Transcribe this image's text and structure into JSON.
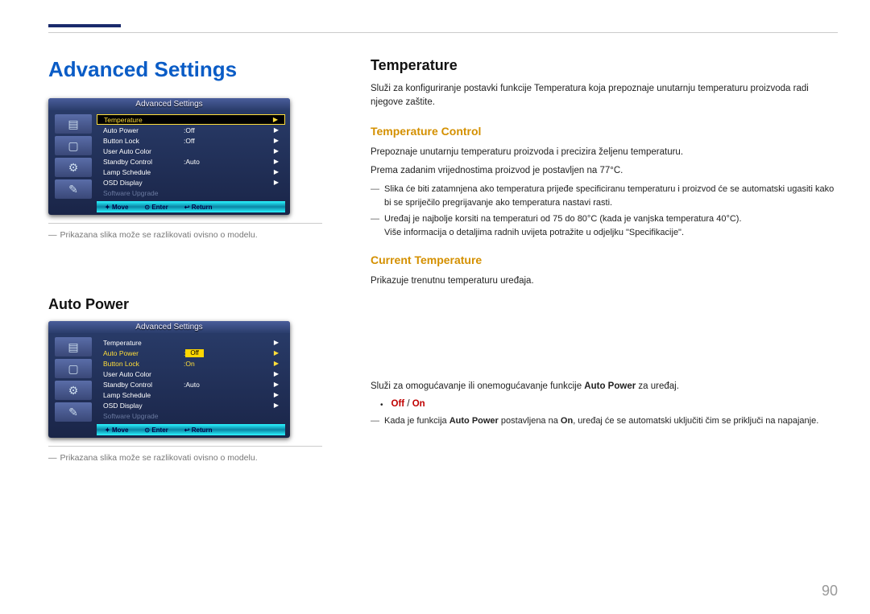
{
  "page_number": "90",
  "headings": {
    "advanced_settings": "Advanced Settings",
    "auto_power": "Auto Power",
    "temperature": "Temperature",
    "temperature_control": "Temperature Control",
    "current_temperature": "Current Temperature"
  },
  "notes": {
    "image_disclaimer": "Prikazana slika može se razlikovati ovisno o modelu.",
    "dash": "―"
  },
  "temperature": {
    "intro": "Služi za konfiguriranje postavki funkcije Temperatura koja prepoznaje unutarnju temperaturu proizvoda radi njegove zaštite.",
    "control_p1": "Prepoznaje unutarnju temperaturu proizvoda i precizira željenu temperaturu.",
    "control_p2": "Prema zadanim vrijednostima proizvod je postavljen na 77°C.",
    "control_n1": "Slika će biti zatamnjena ako temperatura prijeđe specificiranu temperaturu i proizvod će se automatski ugasiti kako bi se spriječilo pregrijavanje ako temperatura nastavi rasti.",
    "control_n2_a": "Uređaj je najbolje korsiti na temperaturi od 75 do 80°C (kada je vanjska temperatura 40°C).",
    "control_n2_b": "Više informacija o detaljima radnih uvijeta potražite u odjeljku \"Specifikacije\".",
    "current_p1": "Prikazuje trenutnu temperaturu uređaja."
  },
  "auto_power": {
    "intro_pre": "Služi za omogućavanje ili onemogućavanje funkcije ",
    "intro_bold": "Auto Power",
    "intro_post": " za uređaj.",
    "opt_off": "Off",
    "opt_sep": " / ",
    "opt_on": "On",
    "note_pre": "Kada je funkcija ",
    "note_mid": " postavljena na ",
    "note_on": "On",
    "note_post": ", uređaj će se automatski uključiti čim se priključi na napajanje."
  },
  "osd": {
    "title": "Advanced Settings",
    "rows": {
      "temperature": "Temperature",
      "auto_power": "Auto Power",
      "button_lock": "Button Lock",
      "user_auto_color": "User Auto Color",
      "standby_control": "Standby Control",
      "lamp_schedule": "Lamp Schedule",
      "osd_display": "OSD Display",
      "software_upgrade": "Software Upgrade"
    },
    "vals": {
      "off": "Off",
      "on": "On",
      "auto": "Auto",
      "colon": ":"
    },
    "bottom": {
      "move": "Move",
      "enter": "Enter",
      "return": "Return"
    },
    "icons": {
      "proj": "▤",
      "monitor": "▢",
      "gear": "⚙",
      "tool": "✎"
    }
  }
}
